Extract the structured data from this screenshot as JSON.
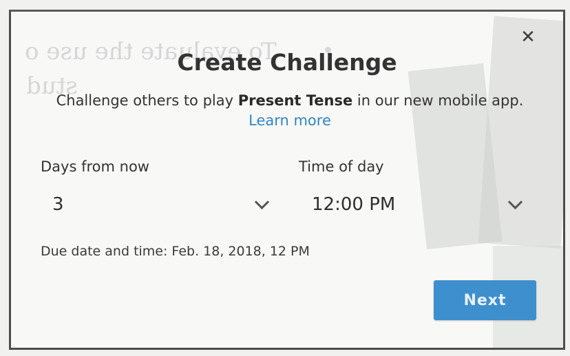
{
  "background_text": {
    "line1": "To evaluate the use o",
    "line2": "stud"
  },
  "dialog": {
    "title": "Create Challenge",
    "description_prefix": "Challenge others to play ",
    "description_bold": "Present Tense",
    "description_suffix": " in our new mobile app. ",
    "learn_more": "Learn more",
    "days_label": "Days from now",
    "days_value": "3",
    "time_label": "Time of day",
    "time_value": "12:00 PM",
    "due_text": "Due date and time: Feb. 18, 2018, 12 PM",
    "next_label": "Next",
    "close_glyph": "✕"
  },
  "colors": {
    "accent": "#3e8fcd",
    "link": "#2f87c8"
  }
}
